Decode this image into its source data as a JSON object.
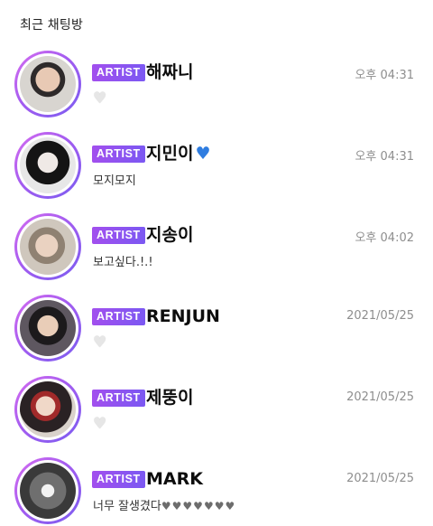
{
  "section_title": "최근 채팅방",
  "chats": [
    {
      "badge": "ARTIST",
      "name": "해짜니",
      "name_emoji": "",
      "time": "오후 04:31",
      "preview": "",
      "preview_icon": "white-heart",
      "preview_icon_glyph": "♥"
    },
    {
      "badge": "ARTIST",
      "name": "지민이",
      "name_emoji": "♥",
      "time": "오후 04:31",
      "preview": "모지모지",
      "preview_icon": "",
      "preview_icon_glyph": ""
    },
    {
      "badge": "ARTIST",
      "name": "지송이",
      "name_emoji": "",
      "time": "오후 04:02",
      "preview": "보고싶다.!.!",
      "preview_icon": "",
      "preview_icon_glyph": ""
    },
    {
      "badge": "ARTIST",
      "name": "RENJUN",
      "name_emoji": "",
      "time": "2021/05/25",
      "preview": "",
      "preview_icon": "white-heart",
      "preview_icon_glyph": "♥"
    },
    {
      "badge": "ARTIST",
      "name": "제뚱이",
      "name_emoji": "",
      "time": "2021/05/25",
      "preview": "",
      "preview_icon": "white-heart",
      "preview_icon_glyph": "♥"
    },
    {
      "badge": "ARTIST",
      "name": "MARK",
      "name_emoji": "",
      "time": "2021/05/25",
      "preview": "너무 잘생겼다",
      "preview_icon": "black-hearts",
      "preview_icon_glyph": "♥♥♥♥♥♥♥"
    }
  ],
  "colors": {
    "badge_gradient_start": "#a24fee",
    "badge_gradient_end": "#7b58f2",
    "avatar_ring_start": "#d76cf0",
    "avatar_ring_end": "#7a5cf0",
    "time_text": "#8e8e8e",
    "name_heart": "#2f7de0"
  }
}
